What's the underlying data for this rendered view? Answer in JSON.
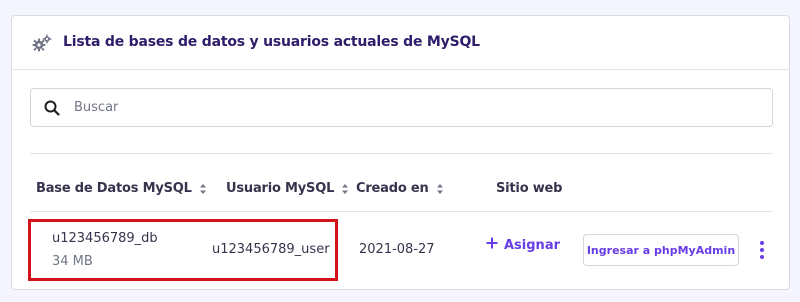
{
  "card": {
    "title": "Lista de bases de datos y usuarios actuales de MySQL",
    "header_icon": "gears-icon"
  },
  "search": {
    "placeholder": "Buscar",
    "value": "",
    "icon": "search-icon"
  },
  "table": {
    "columns": [
      {
        "label": "Base de Datos MySQL",
        "sortable": true
      },
      {
        "label": "Usuario MySQL",
        "sortable": true
      },
      {
        "label": "Creado en",
        "sortable": true
      },
      {
        "label": "Sitio web",
        "sortable": false
      }
    ],
    "rows": [
      {
        "database": "u123456789_db",
        "size": "34 MB",
        "user": "u123456789_user",
        "created": "2021-08-27",
        "website_action": "Asignar",
        "phpmyadmin_label": "Ingresar a phpMyAdmin",
        "more_icon": "more-vertical-icon"
      }
    ]
  },
  "colors": {
    "accent": "#673de6",
    "title": "#2f1c6a",
    "highlight": "#d2131a",
    "background": "#f4f5ff"
  }
}
